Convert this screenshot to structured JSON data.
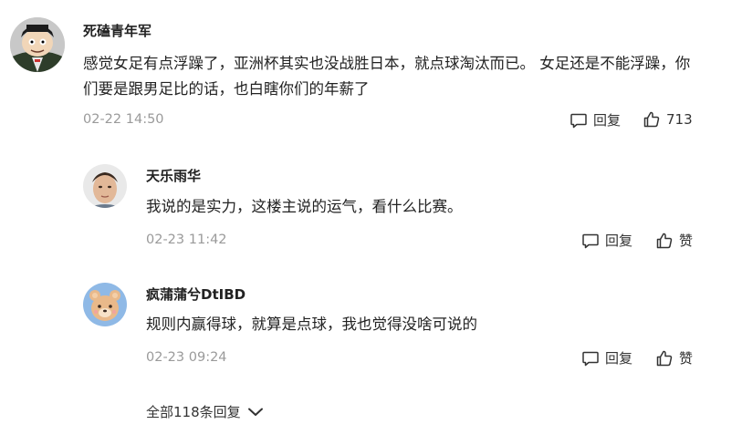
{
  "comments": [
    {
      "username": "死磕青年军",
      "content": "感觉女足有点浮躁了，亚洲杯其实也没战胜日本，就点球淘汰而已。 女足还是不能浮躁，你们要是跟男足比的话，也白瞎你们的年薪了",
      "timestamp": "02-22 14:50",
      "reply_label": "回复",
      "like_count": "713"
    },
    {
      "username": "天乐雨华",
      "content": "我说的是实力，这楼主说的运气，看什么比赛。",
      "timestamp": "02-23 11:42",
      "reply_label": "回复",
      "like_label": "赞"
    },
    {
      "username": "疯蒲蒲兮DtIBD",
      "content": "规则内赢得球，就算是点球，我也觉得没啥可说的",
      "timestamp": "02-23 09:24",
      "reply_label": "回复",
      "like_label": "赞"
    }
  ],
  "expand_replies_label": "全部118条回复",
  "icons": {
    "reply": "comment-bubble-icon",
    "like": "thumbs-up-icon",
    "expand": "chevron-down-icon"
  },
  "colors": {
    "text": "#222222",
    "meta": "#9a9a9a",
    "background": "#ffffff"
  }
}
